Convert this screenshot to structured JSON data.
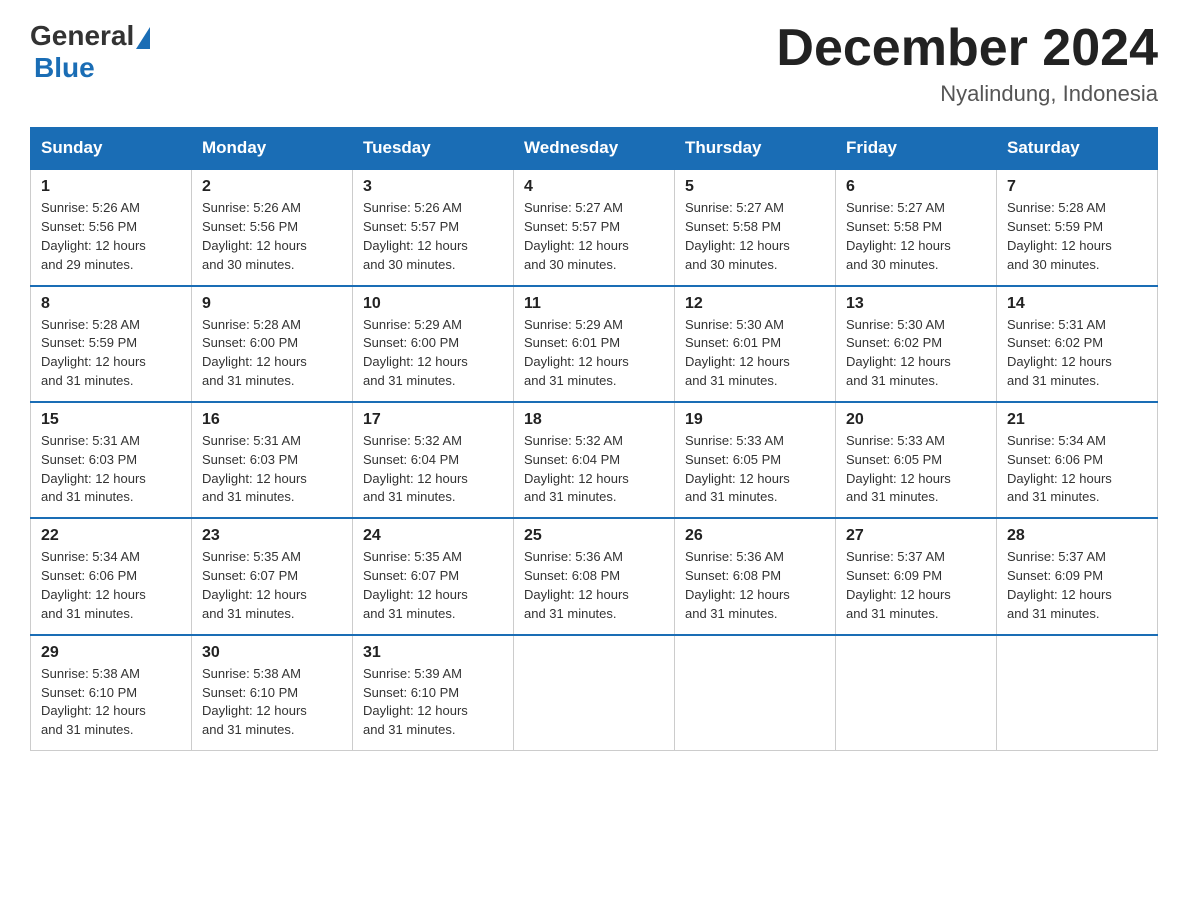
{
  "header": {
    "logo_general": "General",
    "logo_blue": "Blue",
    "month_title": "December 2024",
    "location": "Nyalindung, Indonesia"
  },
  "days_of_week": [
    "Sunday",
    "Monday",
    "Tuesday",
    "Wednesday",
    "Thursday",
    "Friday",
    "Saturday"
  ],
  "weeks": [
    [
      {
        "day": "1",
        "sunrise": "5:26 AM",
        "sunset": "5:56 PM",
        "daylight": "12 hours and 29 minutes."
      },
      {
        "day": "2",
        "sunrise": "5:26 AM",
        "sunset": "5:56 PM",
        "daylight": "12 hours and 30 minutes."
      },
      {
        "day": "3",
        "sunrise": "5:26 AM",
        "sunset": "5:57 PM",
        "daylight": "12 hours and 30 minutes."
      },
      {
        "day": "4",
        "sunrise": "5:27 AM",
        "sunset": "5:57 PM",
        "daylight": "12 hours and 30 minutes."
      },
      {
        "day": "5",
        "sunrise": "5:27 AM",
        "sunset": "5:58 PM",
        "daylight": "12 hours and 30 minutes."
      },
      {
        "day": "6",
        "sunrise": "5:27 AM",
        "sunset": "5:58 PM",
        "daylight": "12 hours and 30 minutes."
      },
      {
        "day": "7",
        "sunrise": "5:28 AM",
        "sunset": "5:59 PM",
        "daylight": "12 hours and 30 minutes."
      }
    ],
    [
      {
        "day": "8",
        "sunrise": "5:28 AM",
        "sunset": "5:59 PM",
        "daylight": "12 hours and 31 minutes."
      },
      {
        "day": "9",
        "sunrise": "5:28 AM",
        "sunset": "6:00 PM",
        "daylight": "12 hours and 31 minutes."
      },
      {
        "day": "10",
        "sunrise": "5:29 AM",
        "sunset": "6:00 PM",
        "daylight": "12 hours and 31 minutes."
      },
      {
        "day": "11",
        "sunrise": "5:29 AM",
        "sunset": "6:01 PM",
        "daylight": "12 hours and 31 minutes."
      },
      {
        "day": "12",
        "sunrise": "5:30 AM",
        "sunset": "6:01 PM",
        "daylight": "12 hours and 31 minutes."
      },
      {
        "day": "13",
        "sunrise": "5:30 AM",
        "sunset": "6:02 PM",
        "daylight": "12 hours and 31 minutes."
      },
      {
        "day": "14",
        "sunrise": "5:31 AM",
        "sunset": "6:02 PM",
        "daylight": "12 hours and 31 minutes."
      }
    ],
    [
      {
        "day": "15",
        "sunrise": "5:31 AM",
        "sunset": "6:03 PM",
        "daylight": "12 hours and 31 minutes."
      },
      {
        "day": "16",
        "sunrise": "5:31 AM",
        "sunset": "6:03 PM",
        "daylight": "12 hours and 31 minutes."
      },
      {
        "day": "17",
        "sunrise": "5:32 AM",
        "sunset": "6:04 PM",
        "daylight": "12 hours and 31 minutes."
      },
      {
        "day": "18",
        "sunrise": "5:32 AM",
        "sunset": "6:04 PM",
        "daylight": "12 hours and 31 minutes."
      },
      {
        "day": "19",
        "sunrise": "5:33 AM",
        "sunset": "6:05 PM",
        "daylight": "12 hours and 31 minutes."
      },
      {
        "day": "20",
        "sunrise": "5:33 AM",
        "sunset": "6:05 PM",
        "daylight": "12 hours and 31 minutes."
      },
      {
        "day": "21",
        "sunrise": "5:34 AM",
        "sunset": "6:06 PM",
        "daylight": "12 hours and 31 minutes."
      }
    ],
    [
      {
        "day": "22",
        "sunrise": "5:34 AM",
        "sunset": "6:06 PM",
        "daylight": "12 hours and 31 minutes."
      },
      {
        "day": "23",
        "sunrise": "5:35 AM",
        "sunset": "6:07 PM",
        "daylight": "12 hours and 31 minutes."
      },
      {
        "day": "24",
        "sunrise": "5:35 AM",
        "sunset": "6:07 PM",
        "daylight": "12 hours and 31 minutes."
      },
      {
        "day": "25",
        "sunrise": "5:36 AM",
        "sunset": "6:08 PM",
        "daylight": "12 hours and 31 minutes."
      },
      {
        "day": "26",
        "sunrise": "5:36 AM",
        "sunset": "6:08 PM",
        "daylight": "12 hours and 31 minutes."
      },
      {
        "day": "27",
        "sunrise": "5:37 AM",
        "sunset": "6:09 PM",
        "daylight": "12 hours and 31 minutes."
      },
      {
        "day": "28",
        "sunrise": "5:37 AM",
        "sunset": "6:09 PM",
        "daylight": "12 hours and 31 minutes."
      }
    ],
    [
      {
        "day": "29",
        "sunrise": "5:38 AM",
        "sunset": "6:10 PM",
        "daylight": "12 hours and 31 minutes."
      },
      {
        "day": "30",
        "sunrise": "5:38 AM",
        "sunset": "6:10 PM",
        "daylight": "12 hours and 31 minutes."
      },
      {
        "day": "31",
        "sunrise": "5:39 AM",
        "sunset": "6:10 PM",
        "daylight": "12 hours and 31 minutes."
      },
      null,
      null,
      null,
      null
    ]
  ],
  "labels": {
    "sunrise": "Sunrise:",
    "sunset": "Sunset:",
    "daylight": "Daylight:"
  }
}
